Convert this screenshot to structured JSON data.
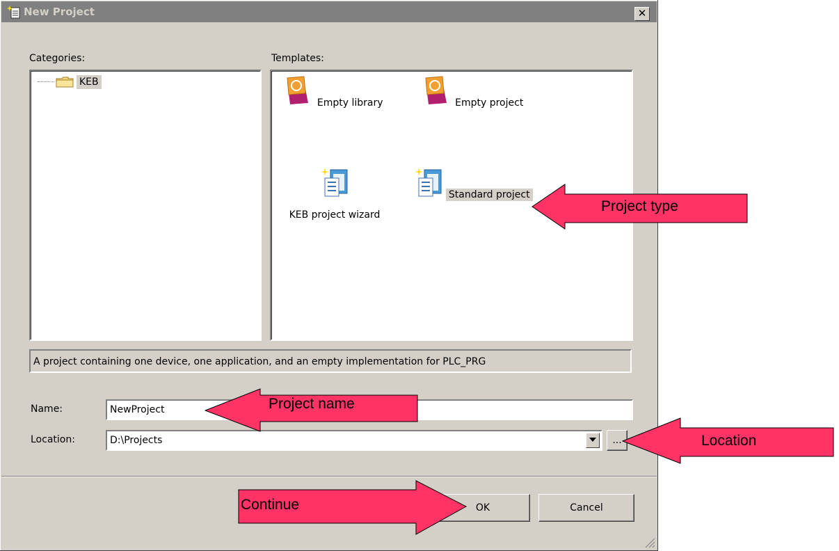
{
  "window": {
    "title": "New Project",
    "close": "✕"
  },
  "categories": {
    "label": "Categories:",
    "items": [
      {
        "label": "KEB"
      }
    ]
  },
  "templates": {
    "label": "Templates:",
    "items": [
      {
        "label": "Empty library",
        "icon": "library-icon"
      },
      {
        "label": "Empty project",
        "icon": "project-icon"
      },
      {
        "label": "KEB project wizard",
        "icon": "wizard-icon"
      },
      {
        "label": "Standard project",
        "icon": "standard-project-icon",
        "selected": true
      }
    ]
  },
  "description": "A project containing one device, one application, and an empty implementation for PLC_PRG",
  "form": {
    "name_label": "Name:",
    "name_value": "NewProject",
    "location_label": "Location:",
    "location_value": "D:\\Projects",
    "browse_label": "..."
  },
  "buttons": {
    "ok": "OK",
    "cancel": "Cancel"
  },
  "annotations": {
    "project_type": "Project type",
    "project_name": "Project name",
    "location": "Location",
    "continue": "Continue"
  },
  "colors": {
    "arrow": "#ff3366",
    "dialog": "#d4d0c8",
    "title_bar": "#808080"
  }
}
